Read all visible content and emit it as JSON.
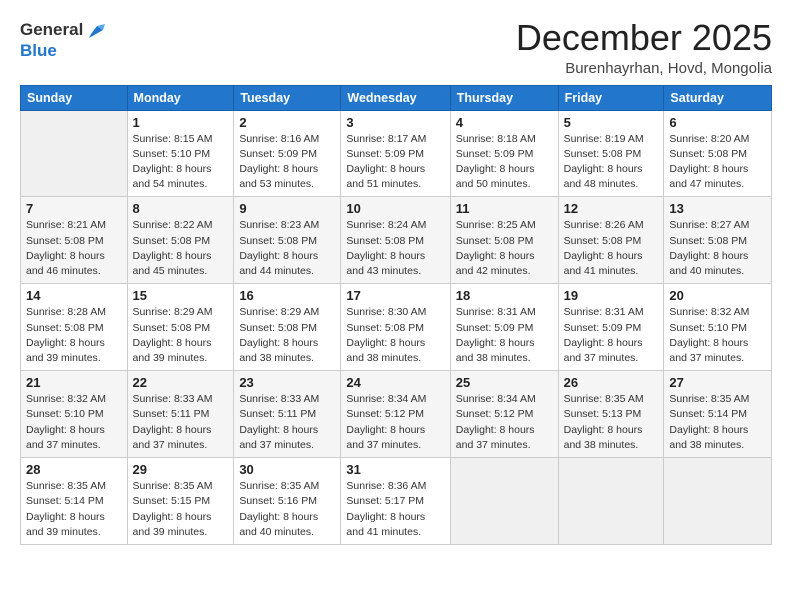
{
  "header": {
    "logo_general": "General",
    "logo_blue": "Blue",
    "month_title": "December 2025",
    "location": "Burenhayrhan, Hovd, Mongolia"
  },
  "days_of_week": [
    "Sunday",
    "Monday",
    "Tuesday",
    "Wednesday",
    "Thursday",
    "Friday",
    "Saturday"
  ],
  "weeks": [
    [
      {
        "day": "",
        "info": ""
      },
      {
        "day": "1",
        "info": "Sunrise: 8:15 AM\nSunset: 5:10 PM\nDaylight: 8 hours\nand 54 minutes."
      },
      {
        "day": "2",
        "info": "Sunrise: 8:16 AM\nSunset: 5:09 PM\nDaylight: 8 hours\nand 53 minutes."
      },
      {
        "day": "3",
        "info": "Sunrise: 8:17 AM\nSunset: 5:09 PM\nDaylight: 8 hours\nand 51 minutes."
      },
      {
        "day": "4",
        "info": "Sunrise: 8:18 AM\nSunset: 5:09 PM\nDaylight: 8 hours\nand 50 minutes."
      },
      {
        "day": "5",
        "info": "Sunrise: 8:19 AM\nSunset: 5:08 PM\nDaylight: 8 hours\nand 48 minutes."
      },
      {
        "day": "6",
        "info": "Sunrise: 8:20 AM\nSunset: 5:08 PM\nDaylight: 8 hours\nand 47 minutes."
      }
    ],
    [
      {
        "day": "7",
        "info": "Sunrise: 8:21 AM\nSunset: 5:08 PM\nDaylight: 8 hours\nand 46 minutes."
      },
      {
        "day": "8",
        "info": "Sunrise: 8:22 AM\nSunset: 5:08 PM\nDaylight: 8 hours\nand 45 minutes."
      },
      {
        "day": "9",
        "info": "Sunrise: 8:23 AM\nSunset: 5:08 PM\nDaylight: 8 hours\nand 44 minutes."
      },
      {
        "day": "10",
        "info": "Sunrise: 8:24 AM\nSunset: 5:08 PM\nDaylight: 8 hours\nand 43 minutes."
      },
      {
        "day": "11",
        "info": "Sunrise: 8:25 AM\nSunset: 5:08 PM\nDaylight: 8 hours\nand 42 minutes."
      },
      {
        "day": "12",
        "info": "Sunrise: 8:26 AM\nSunset: 5:08 PM\nDaylight: 8 hours\nand 41 minutes."
      },
      {
        "day": "13",
        "info": "Sunrise: 8:27 AM\nSunset: 5:08 PM\nDaylight: 8 hours\nand 40 minutes."
      }
    ],
    [
      {
        "day": "14",
        "info": "Sunrise: 8:28 AM\nSunset: 5:08 PM\nDaylight: 8 hours\nand 39 minutes."
      },
      {
        "day": "15",
        "info": "Sunrise: 8:29 AM\nSunset: 5:08 PM\nDaylight: 8 hours\nand 39 minutes."
      },
      {
        "day": "16",
        "info": "Sunrise: 8:29 AM\nSunset: 5:08 PM\nDaylight: 8 hours\nand 38 minutes."
      },
      {
        "day": "17",
        "info": "Sunrise: 8:30 AM\nSunset: 5:08 PM\nDaylight: 8 hours\nand 38 minutes."
      },
      {
        "day": "18",
        "info": "Sunrise: 8:31 AM\nSunset: 5:09 PM\nDaylight: 8 hours\nand 38 minutes."
      },
      {
        "day": "19",
        "info": "Sunrise: 8:31 AM\nSunset: 5:09 PM\nDaylight: 8 hours\nand 37 minutes."
      },
      {
        "day": "20",
        "info": "Sunrise: 8:32 AM\nSunset: 5:10 PM\nDaylight: 8 hours\nand 37 minutes."
      }
    ],
    [
      {
        "day": "21",
        "info": "Sunrise: 8:32 AM\nSunset: 5:10 PM\nDaylight: 8 hours\nand 37 minutes."
      },
      {
        "day": "22",
        "info": "Sunrise: 8:33 AM\nSunset: 5:11 PM\nDaylight: 8 hours\nand 37 minutes."
      },
      {
        "day": "23",
        "info": "Sunrise: 8:33 AM\nSunset: 5:11 PM\nDaylight: 8 hours\nand 37 minutes."
      },
      {
        "day": "24",
        "info": "Sunrise: 8:34 AM\nSunset: 5:12 PM\nDaylight: 8 hours\nand 37 minutes."
      },
      {
        "day": "25",
        "info": "Sunrise: 8:34 AM\nSunset: 5:12 PM\nDaylight: 8 hours\nand 37 minutes."
      },
      {
        "day": "26",
        "info": "Sunrise: 8:35 AM\nSunset: 5:13 PM\nDaylight: 8 hours\nand 38 minutes."
      },
      {
        "day": "27",
        "info": "Sunrise: 8:35 AM\nSunset: 5:14 PM\nDaylight: 8 hours\nand 38 minutes."
      }
    ],
    [
      {
        "day": "28",
        "info": "Sunrise: 8:35 AM\nSunset: 5:14 PM\nDaylight: 8 hours\nand 39 minutes."
      },
      {
        "day": "29",
        "info": "Sunrise: 8:35 AM\nSunset: 5:15 PM\nDaylight: 8 hours\nand 39 minutes."
      },
      {
        "day": "30",
        "info": "Sunrise: 8:35 AM\nSunset: 5:16 PM\nDaylight: 8 hours\nand 40 minutes."
      },
      {
        "day": "31",
        "info": "Sunrise: 8:36 AM\nSunset: 5:17 PM\nDaylight: 8 hours\nand 41 minutes."
      },
      {
        "day": "",
        "info": ""
      },
      {
        "day": "",
        "info": ""
      },
      {
        "day": "",
        "info": ""
      }
    ]
  ]
}
